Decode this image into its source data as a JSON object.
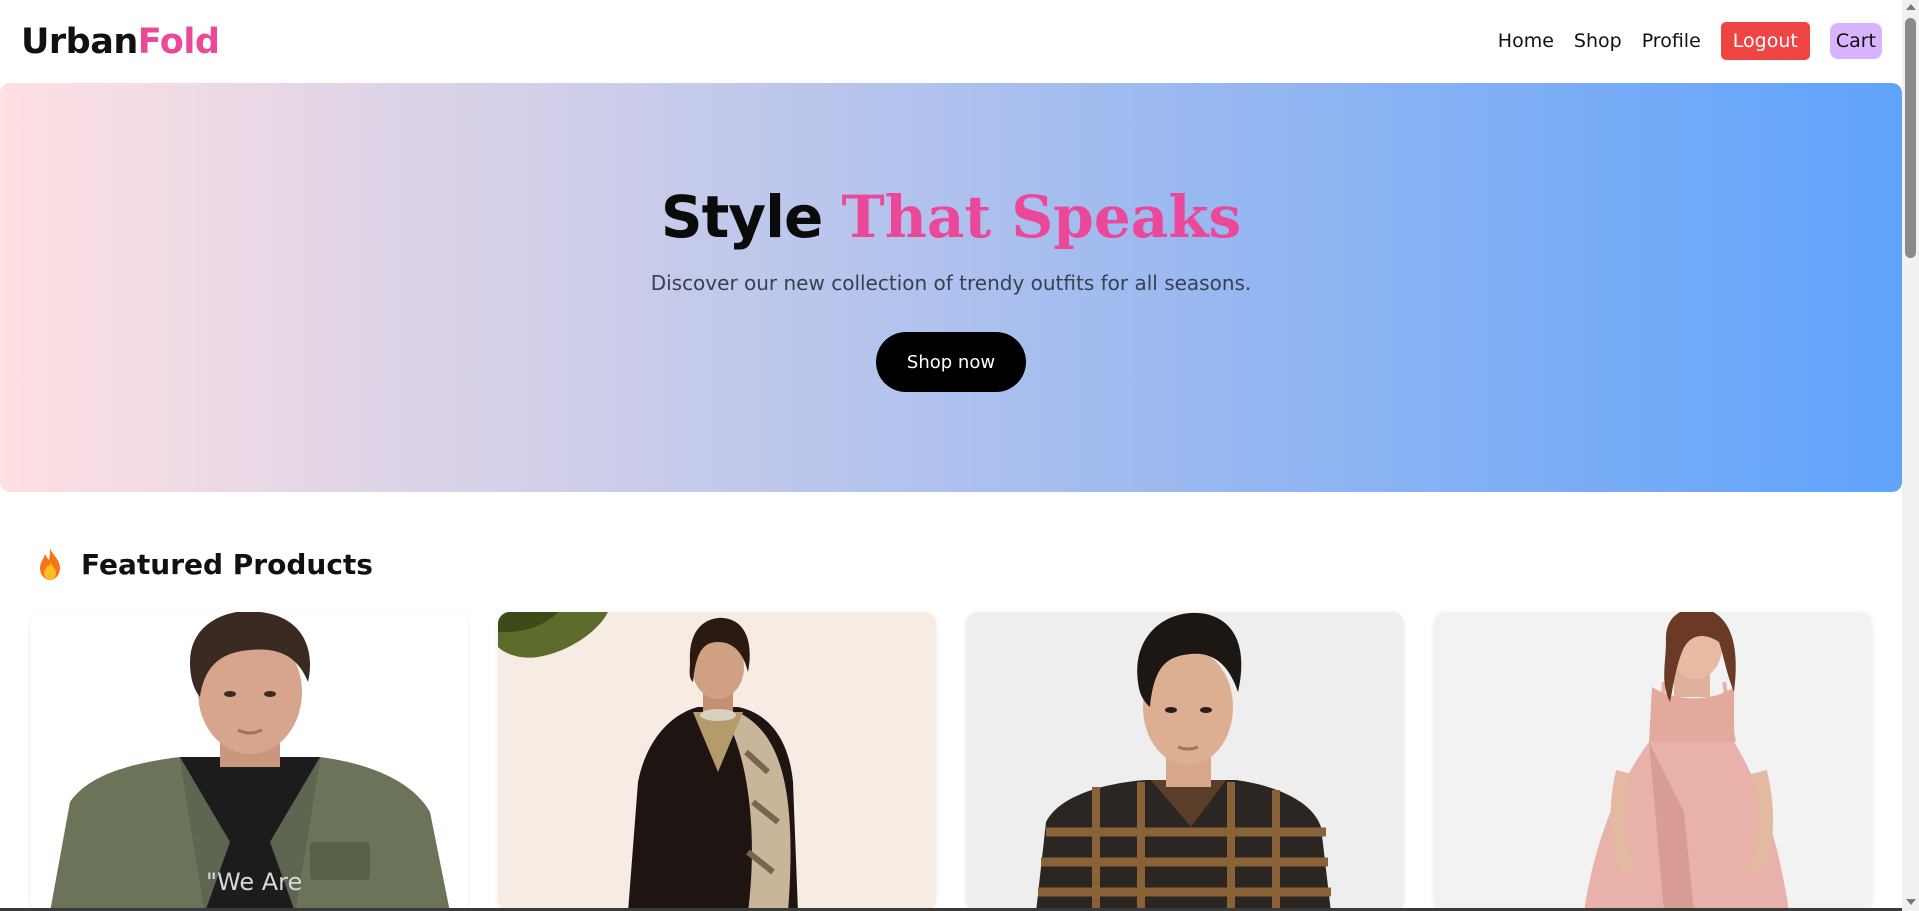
{
  "header": {
    "logo_part1": "Urban",
    "logo_part2": "Fold",
    "nav": {
      "home": "Home",
      "shop": "Shop",
      "profile": "Profile",
      "logout": "Logout",
      "cart": "Cart"
    }
  },
  "hero": {
    "title_part1": "Style ",
    "title_part2": "That Speaks",
    "subtitle": "Discover our new collection of trendy outfits for all seasons.",
    "cta": "Shop now"
  },
  "featured": {
    "icon": "fire-icon",
    "title": "Featured Products",
    "products": [
      {
        "image": "man-olive-jacket-photo"
      },
      {
        "image": "woman-black-embroidered-kurta-photo"
      },
      {
        "image": "man-plaid-shirt-photo"
      },
      {
        "image": "woman-pink-dress-photo"
      }
    ]
  },
  "colors": {
    "brand_pink": "#ec4899",
    "logout_red": "#ef4444",
    "cart_purple": "#d8b4fe",
    "hero_gradient_start": "#ffe0e3",
    "hero_gradient_end": "#5fa3fb"
  }
}
